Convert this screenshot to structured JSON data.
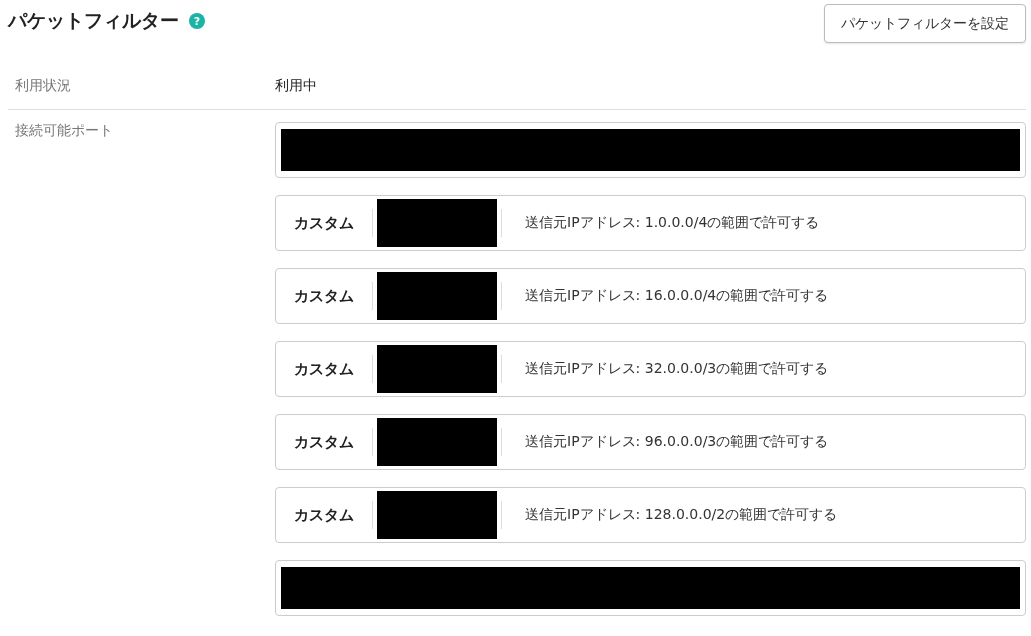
{
  "header": {
    "title": "パケットフィルター",
    "help": "?",
    "button": "パケットフィルターを設定"
  },
  "status": {
    "label": "利用状況",
    "value": "利用中"
  },
  "ports": {
    "label": "接続可能ポート",
    "items": [
      {
        "kind": "redacted"
      },
      {
        "kind": "rule",
        "type": "カスタム",
        "source": "送信元IPアドレス: 1.0.0.0/4の範囲で許可する"
      },
      {
        "kind": "rule",
        "type": "カスタム",
        "source": "送信元IPアドレス: 16.0.0.0/4の範囲で許可する"
      },
      {
        "kind": "rule",
        "type": "カスタム",
        "source": "送信元IPアドレス: 32.0.0.0/3の範囲で許可する"
      },
      {
        "kind": "rule",
        "type": "カスタム",
        "source": "送信元IPアドレス: 96.0.0.0/3の範囲で許可する"
      },
      {
        "kind": "rule",
        "type": "カスタム",
        "source": "送信元IPアドレス: 128.0.0.0/2の範囲で許可する"
      },
      {
        "kind": "redacted"
      }
    ]
  }
}
